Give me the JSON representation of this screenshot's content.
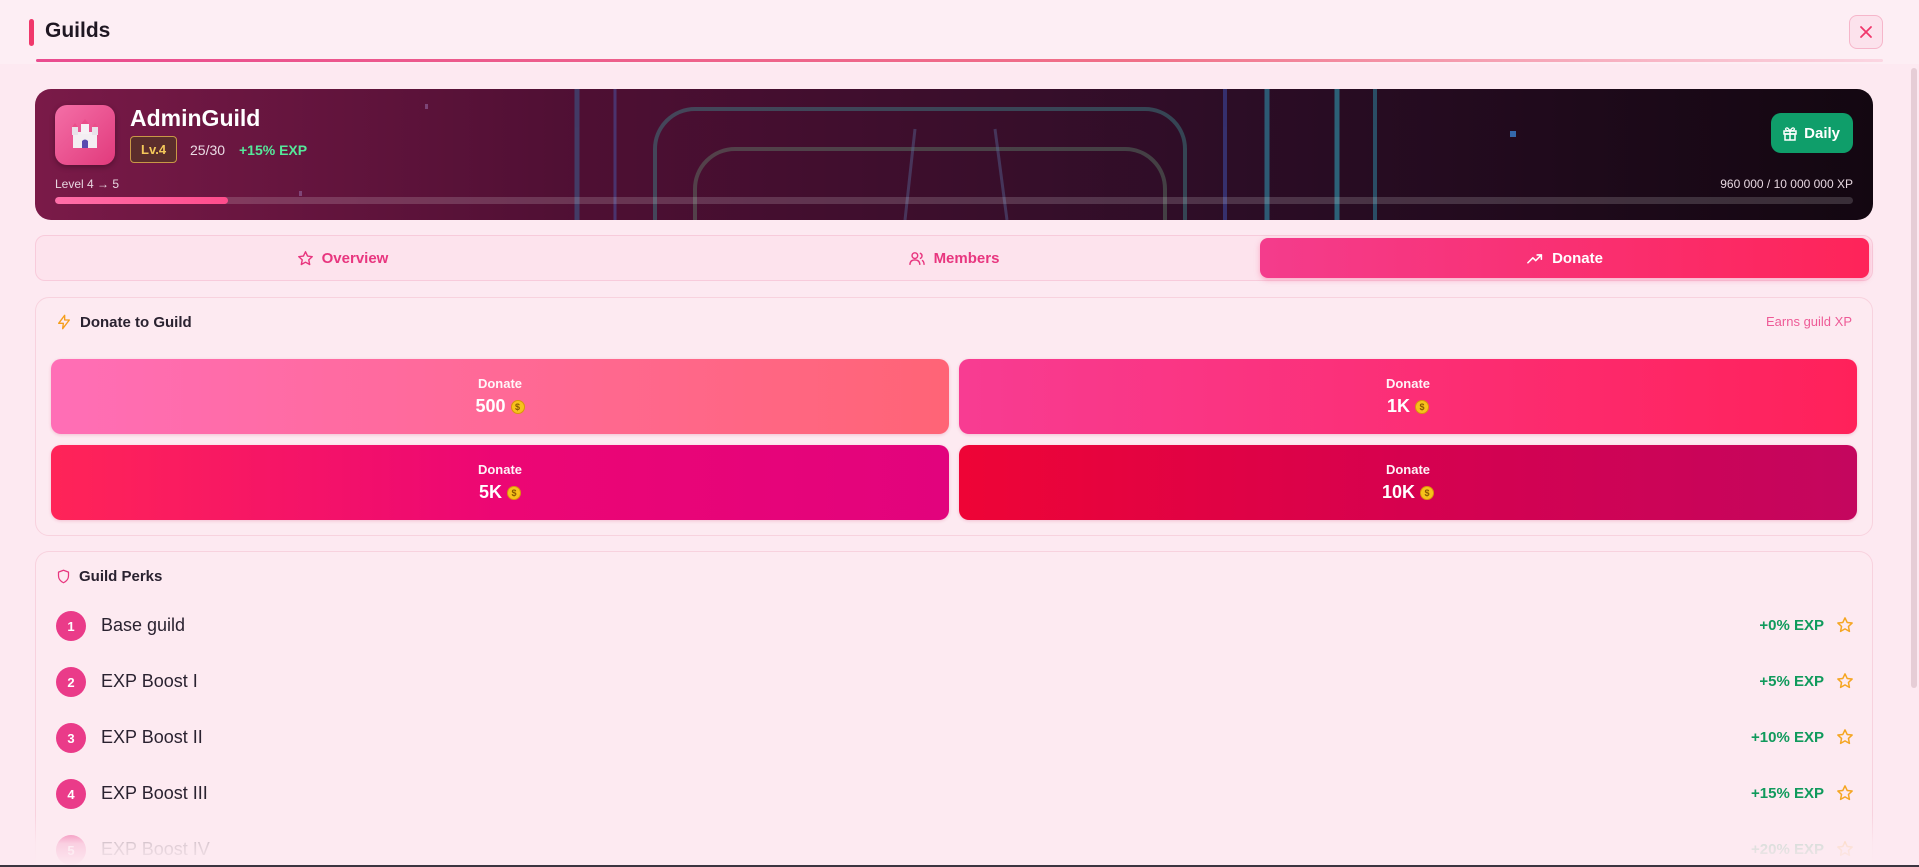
{
  "header": {
    "title": "Guilds"
  },
  "guild": {
    "name": "AdminGuild",
    "level_badge": "Lv.4",
    "members": "25/30",
    "exp_bonus": "+15% EXP",
    "level_range": "Level 4 → 5",
    "xp_text": "960 000 / 10 000 000 XP",
    "xp_progress": 0.096,
    "daily_label": "Daily"
  },
  "tabs": [
    {
      "label": "Overview",
      "icon": "star-icon"
    },
    {
      "label": "Members",
      "icon": "users-icon"
    },
    {
      "label": "Donate",
      "icon": "trending-up-icon",
      "active": true
    }
  ],
  "donate": {
    "title": "Donate to Guild",
    "note": "Earns guild XP",
    "buttons": [
      {
        "label": "Donate",
        "amount": "500"
      },
      {
        "label": "Donate",
        "amount": "1K"
      },
      {
        "label": "Donate",
        "amount": "5K"
      },
      {
        "label": "Donate",
        "amount": "10K"
      }
    ]
  },
  "perks": {
    "title": "Guild Perks",
    "items": [
      {
        "num": "1",
        "name": "Base guild",
        "exp": "+0% EXP"
      },
      {
        "num": "2",
        "name": "EXP Boost I",
        "exp": "+5% EXP"
      },
      {
        "num": "3",
        "name": "EXP Boost II",
        "exp": "+10% EXP"
      },
      {
        "num": "4",
        "name": "EXP Boost III",
        "exp": "+15% EXP"
      },
      {
        "num": "5",
        "name": "EXP Boost IV",
        "exp": "+20% EXP"
      }
    ]
  },
  "colors": {
    "accent": "#f0386b",
    "tab_active": "#f43c8c",
    "exp_green": "#109a5c",
    "daily_green": "#0f9e6a",
    "gold": "#f4c85a"
  }
}
